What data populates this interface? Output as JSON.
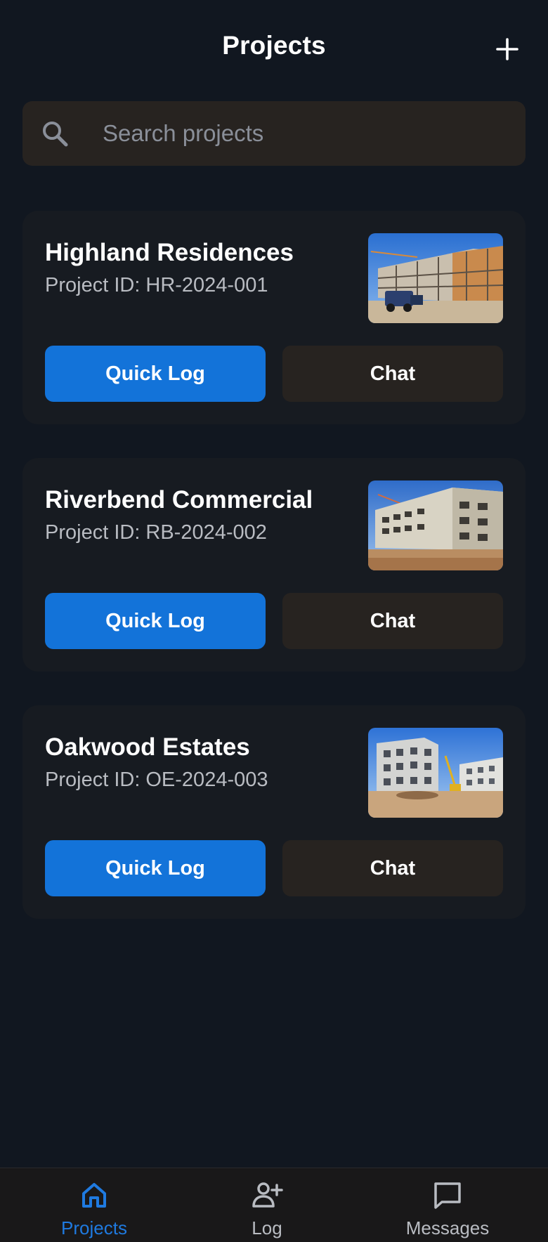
{
  "header": {
    "title": "Projects",
    "add_icon": "plus-icon"
  },
  "search": {
    "placeholder": "Search projects",
    "value": "",
    "icon": "search-icon"
  },
  "projects": [
    {
      "name": "Highland Residences",
      "id_label": "Project ID:",
      "id": "HR-2024-001",
      "quick_log_label": "Quick Log",
      "chat_label": "Chat"
    },
    {
      "name": "Riverbend Commercial",
      "id_label": "Project ID:",
      "id": "RB-2024-002",
      "quick_log_label": "Quick Log",
      "chat_label": "Chat"
    },
    {
      "name": "Oakwood Estates",
      "id_label": "Project ID:",
      "id": "OE-2024-003",
      "quick_log_label": "Quick Log",
      "chat_label": "Chat"
    }
  ],
  "bottom_nav": {
    "items": [
      {
        "label": "Projects",
        "icon": "home-icon",
        "active": true
      },
      {
        "label": "Log",
        "icon": "person-add-icon",
        "active": false
      },
      {
        "label": "Messages",
        "icon": "chat-bubble-icon",
        "active": false
      }
    ]
  },
  "colors": {
    "background": "#111720",
    "card": "#171b21",
    "primary": "#1373d9",
    "secondary_button": "#272320",
    "nav_active": "#1f7ae0",
    "nav_inactive": "#b9bcc2"
  }
}
